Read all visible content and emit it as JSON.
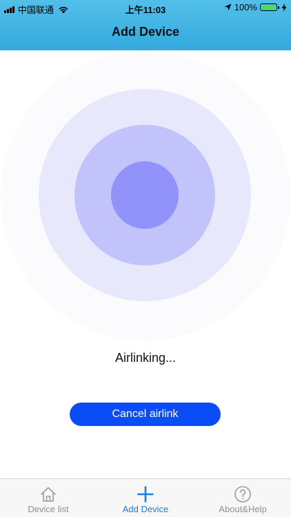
{
  "status_bar": {
    "carrier": "中国联通",
    "time": "上午11:03",
    "battery_percent": "100%",
    "battery_level": 1.0,
    "battery_color": "#4cd964"
  },
  "nav": {
    "title": "Add Device"
  },
  "colors": {
    "header_top": "#52bfea",
    "header_bottom": "#34a9dd",
    "accent": "#0a4cf5",
    "tab_active": "#1a7ce0",
    "tab_inactive": "#8e8e93",
    "ring_colors": [
      "#fbfbfe",
      "#e8e8fd",
      "#c2c3fb",
      "#9193fb"
    ]
  },
  "main": {
    "status_text": "Airlinking...",
    "cancel_label": "Cancel airlink"
  },
  "tab_bar": {
    "tabs": [
      {
        "label": "Device list",
        "icon": "home-icon",
        "active": false
      },
      {
        "label": "Add Device",
        "icon": "plus-icon",
        "active": true
      },
      {
        "label": "About&Help",
        "icon": "help-circle-icon",
        "active": false
      }
    ]
  }
}
